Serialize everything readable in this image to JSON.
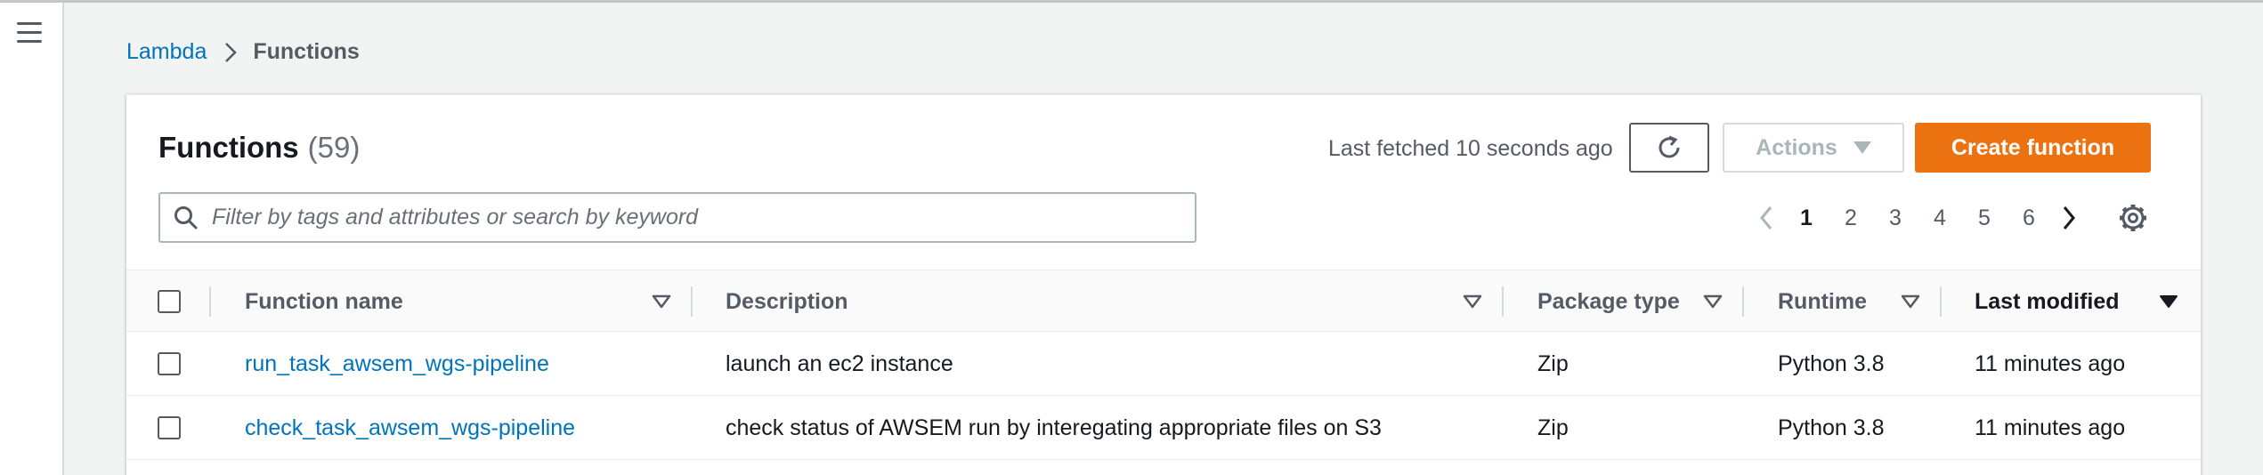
{
  "breadcrumb": {
    "parent": "Lambda",
    "current": "Functions"
  },
  "panel": {
    "title": "Functions",
    "count": "(59)",
    "last_fetched": "Last fetched 10 seconds ago",
    "actions_label": "Actions",
    "create_label": "Create function"
  },
  "search": {
    "placeholder": "Filter by tags and attributes or search by keyword",
    "value": ""
  },
  "pagination": {
    "pages": [
      "1",
      "2",
      "3",
      "4",
      "5",
      "6"
    ],
    "current": "1"
  },
  "table": {
    "columns": {
      "name": "Function name",
      "description": "Description",
      "package": "Package type",
      "runtime": "Runtime",
      "modified": "Last modified"
    },
    "sorted_by": "Last modified",
    "rows": [
      {
        "name": "run_task_awsem_wgs-pipeline",
        "description": "launch an ec2 instance",
        "package": "Zip",
        "runtime": "Python 3.8",
        "modified": "11 minutes ago"
      },
      {
        "name": "check_task_awsem_wgs-pipeline",
        "description": "check status of AWSEM run by interegating appropriate files on S3",
        "package": "Zip",
        "runtime": "Python 3.8",
        "modified": "11 minutes ago"
      }
    ]
  },
  "icons": {
    "menu": "hamburger-menu-icon",
    "breadcrumb_separator": "chevron-right-icon",
    "refresh": "refresh-icon",
    "actions_caret": "caret-down-icon",
    "search": "search-icon",
    "pager_prev": "chevron-left-icon",
    "pager_next": "chevron-right-icon",
    "settings": "gear-icon",
    "column_sort": "caret-down-outline-icon",
    "active_sort": "caret-down-filled-icon"
  },
  "colors": {
    "accent_orange": "#ec7211",
    "link_blue": "#0073bb",
    "background": "#f2f3f3",
    "text_dark": "#16191f",
    "text_muted": "#545b64"
  }
}
